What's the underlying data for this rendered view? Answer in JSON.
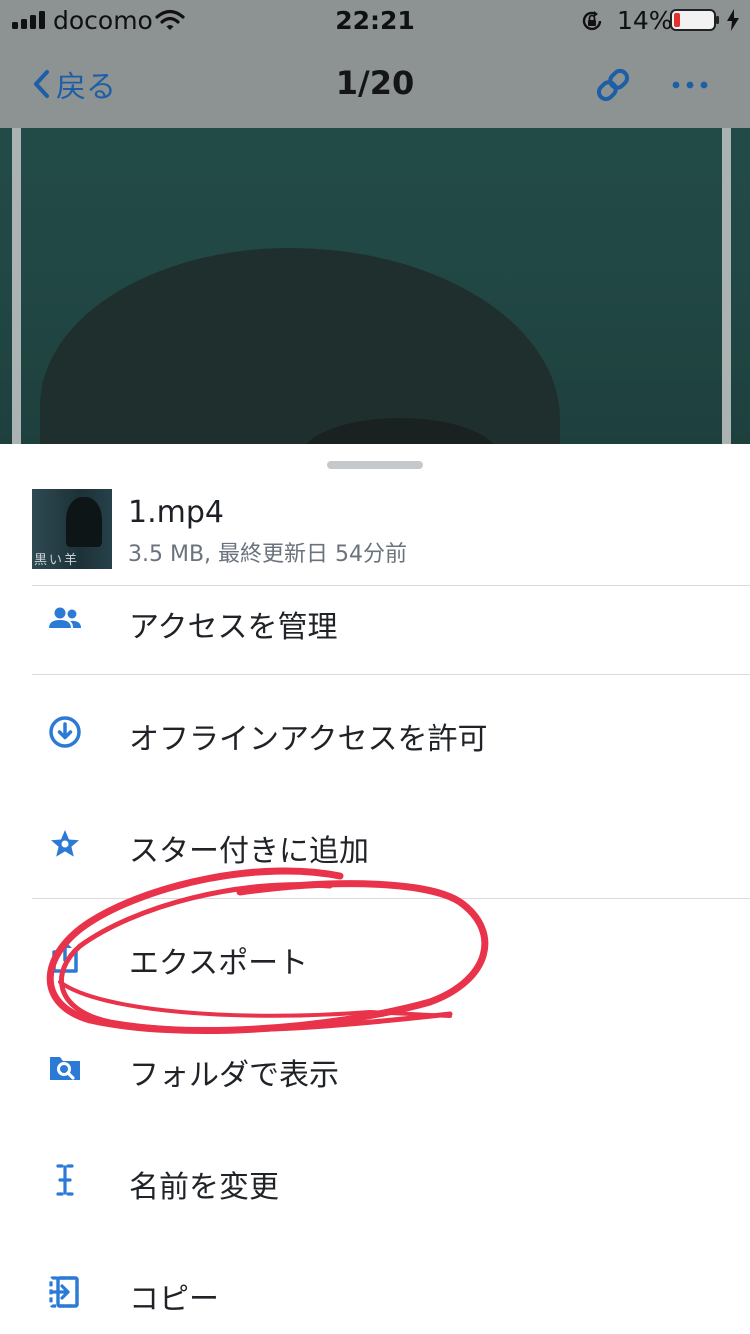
{
  "status_bar": {
    "carrier": "docomo",
    "time": "22:21",
    "battery_percent": "14%",
    "battery_level": 0.14
  },
  "nav": {
    "back_label": "戻る",
    "page_counter": "1/20"
  },
  "file": {
    "name": "1.mp4",
    "meta": "3.5 MB, 最終更新日 54分前",
    "thumbnail_text": "黒い羊"
  },
  "menu": [
    {
      "label": "アクセスを管理",
      "icon": "people-icon"
    },
    {
      "label": "オフラインアクセスを許可",
      "icon": "download-circle-icon"
    },
    {
      "label": "スター付きに追加",
      "icon": "star-icon"
    },
    {
      "label": "エクスポート",
      "icon": "export-icon"
    },
    {
      "label": "フォルダで表示",
      "icon": "folder-search-icon"
    },
    {
      "label": "名前を変更",
      "icon": "rename-cursor-icon"
    },
    {
      "label": "コピー",
      "icon": "copy-icon"
    }
  ],
  "colors": {
    "accent": "#2b7bd6",
    "nav_accent": "#1d5fa6",
    "annotation": "#e8334a",
    "battery_low": "#e0322e"
  }
}
